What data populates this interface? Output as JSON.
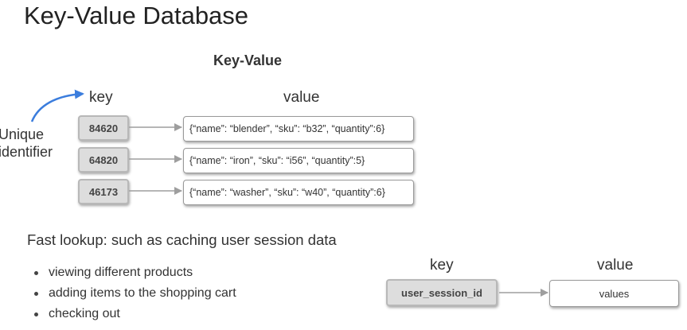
{
  "title": "Key-Value Database",
  "diagram": {
    "title": "Key-Value",
    "key_heading": "key",
    "value_heading": "value",
    "annotation": "Unique\nidentifier",
    "rows": [
      {
        "key": "84620",
        "value": "{“name”: “blender”, “sku”: “b32”, “quantity”:6}"
      },
      {
        "key": "64820",
        "value": "{“name”: “iron”, “sku”: “i56”, “quantity”:5}"
      },
      {
        "key": "46173",
        "value": "{“name”: “washer”, “sku”: “w40”, “quantity”:6}"
      }
    ],
    "colors": {
      "key_fill": "#dddddd",
      "arrow": "#9e9e9e",
      "annotation_arrow": "#3b7ddd"
    }
  },
  "use_case": {
    "heading": "Fast lookup: such as caching user session data",
    "bullets": [
      "viewing different products",
      "adding items to the shopping cart",
      "checking out"
    ],
    "example": {
      "key_heading": "key",
      "value_heading": "value",
      "key": "user_session_id",
      "value": "values"
    }
  }
}
